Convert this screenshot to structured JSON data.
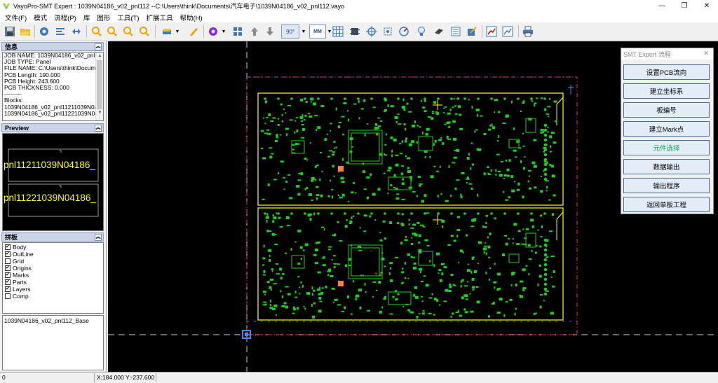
{
  "window": {
    "title": "VayoPro-SMT Expert : 1039N04186_v02_pnl112  --C:\\Users\\think\\Documents\\汽车电子\\1039N04186_v02_pnl112.vayo",
    "minimize": "—",
    "maximize": "❐",
    "close": "✕"
  },
  "menu": [
    {
      "label": "文件(F)"
    },
    {
      "label": "模式"
    },
    {
      "label": "流程(P)"
    },
    {
      "label": "库"
    },
    {
      "label": "图形"
    },
    {
      "label": "工具(T)"
    },
    {
      "label": "扩展工具"
    },
    {
      "label": "帮助(H)"
    }
  ],
  "toolbar": {
    "rotate_label": "90°",
    "unit_label": "MM"
  },
  "info_panel": {
    "header": "信息",
    "lines": [
      "JOB NAME: 1039N04186_v02_pnl1",
      "JOB TYPE: Panel",
      "FILE NAME: C:\\Users\\think\\Docum",
      "PCB Length: 190.000",
      "PCB Height: 243.600",
      "PCB THICKNESS: 0.000",
      "---------",
      "Blocks:",
      "1039N04186_v02_pnl11211039N04",
      "1039N04186_v02_pnl11221039N04"
    ]
  },
  "preview_panel": {
    "header": "Preview",
    "labels": [
      "pnl11211039N04186_",
      "pnl11221039N04186_"
    ]
  },
  "layers_panel": {
    "header": "拼板",
    "items": [
      {
        "label": "Body",
        "checked": true
      },
      {
        "label": "OutLine",
        "checked": true
      },
      {
        "label": "Grid",
        "checked": false
      },
      {
        "label": "Origins",
        "checked": true
      },
      {
        "label": "Marks",
        "checked": true
      },
      {
        "label": "Parts",
        "checked": true
      },
      {
        "label": "Layers",
        "checked": true
      },
      {
        "label": "Comp",
        "checked": false
      }
    ],
    "checkmark": "✔"
  },
  "base_panel": {
    "text": "1039N04186_v02_pnl112_Base"
  },
  "flow_window": {
    "title": "SMT Expert 流程",
    "close": "✕",
    "buttons": [
      {
        "label": "设置PCB流向",
        "active": false
      },
      {
        "label": "建立坐标系",
        "active": false
      },
      {
        "label": "板编号",
        "active": false
      },
      {
        "label": "建立Mark点",
        "active": false
      },
      {
        "label": "元件选择",
        "active": true
      },
      {
        "label": "数据输出",
        "active": false
      },
      {
        "label": "输出程序",
        "active": false
      },
      {
        "label": "返回单板工程",
        "active": false
      }
    ]
  },
  "status": {
    "left": "0",
    "coords": "X:184.000 Y:-237.600"
  },
  "colors": {
    "pcb_outline": "#ffff00",
    "panel_frame": "#ff2020",
    "component": "#1bd11b",
    "highlight": "#ff8040"
  }
}
